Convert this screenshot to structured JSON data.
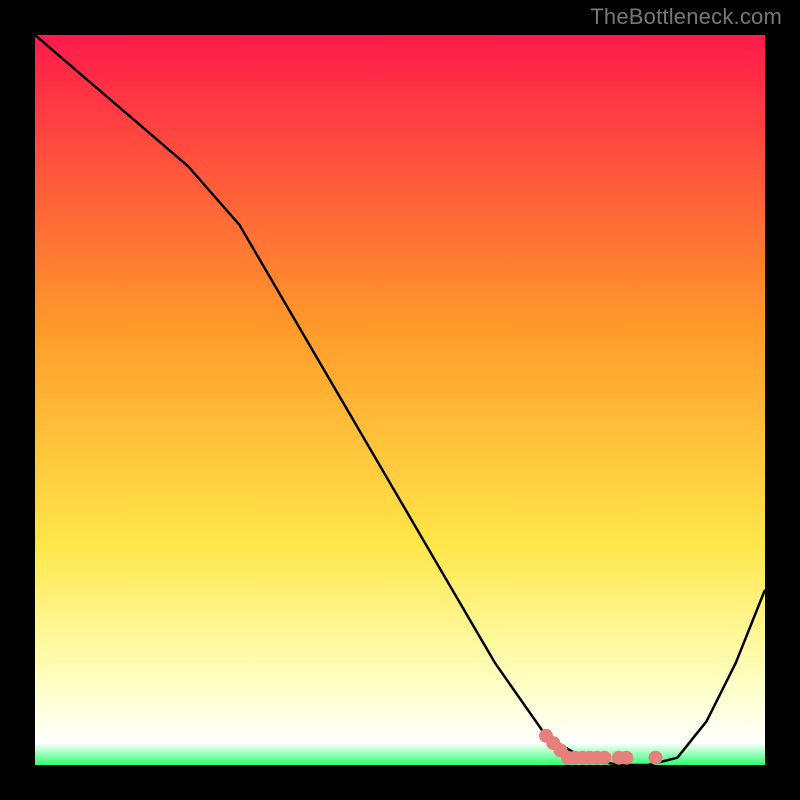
{
  "watermark": "TheBottleneck.com",
  "colors": {
    "bg_black": "#000000",
    "wm_grey": "#777777",
    "curve_black": "#000000",
    "marker_pink": "#e5807a",
    "grad_top": "#ff1a4b",
    "grad_orange": "#ff9a2a",
    "grad_yellow": "#ffe74a",
    "grad_pale_yellow": "#ffffbf",
    "grad_green": "#2cff6f"
  },
  "chart_data": {
    "type": "line",
    "title": "",
    "xlabel": "",
    "ylabel": "",
    "xlim": [
      0,
      100
    ],
    "ylim": [
      0,
      100
    ],
    "grid": false,
    "legend": false,
    "series": [
      {
        "name": "curve",
        "x": [
          0,
          7,
          14,
          21,
          28,
          35,
          42,
          49,
          56,
          63,
          70,
          75,
          80,
          84,
          88,
          92,
          96,
          100
        ],
        "values": [
          100,
          94,
          88,
          82,
          74,
          62,
          50,
          38,
          26,
          14,
          4,
          1,
          0,
          0,
          1,
          6,
          14,
          24
        ]
      }
    ],
    "markers": {
      "name": "highlight",
      "x": [
        70,
        71,
        72,
        73,
        74,
        75,
        76,
        77,
        78,
        80,
        81,
        85
      ],
      "values": [
        4,
        3,
        2,
        1,
        1,
        1,
        1,
        1,
        1,
        1,
        1,
        1
      ]
    },
    "background_gradient_stops": [
      {
        "pos": 0,
        "color": "#ff1a4b"
      },
      {
        "pos": 40,
        "color": "#ff9a2a"
      },
      {
        "pos": 70,
        "color": "#ffe74a"
      },
      {
        "pos": 88,
        "color": "#ffffbf"
      },
      {
        "pos": 97,
        "color": "#ffffff"
      },
      {
        "pos": 100,
        "color": "#2cff6f"
      }
    ]
  }
}
